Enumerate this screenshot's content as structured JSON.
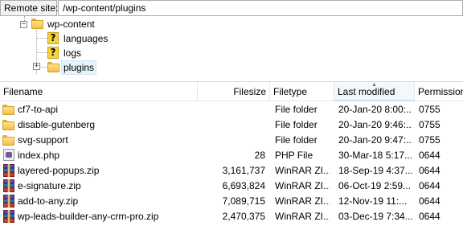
{
  "remote": {
    "label": "Remote site:",
    "path": "/wp-content/plugins"
  },
  "tree": {
    "root": {
      "label": "wp-content",
      "icon": "folder-open-icon",
      "expander": "−"
    },
    "children": [
      {
        "label": "languages",
        "icon": "unknown-folder-icon"
      },
      {
        "label": "logs",
        "icon": "unknown-folder-icon"
      },
      {
        "label": "plugins",
        "icon": "folder-icon",
        "expander": "+",
        "selected": true
      }
    ]
  },
  "columns": {
    "filename": "Filename",
    "filesize": "Filesize",
    "filetype": "Filetype",
    "last_modified": "Last modified",
    "permissions": "Permission"
  },
  "sorted_column": "last_modified",
  "files": [
    {
      "name": "cf7-to-api",
      "size": "",
      "type": "File folder",
      "modified": "20-Jan-20 8:00:...",
      "perm": "0755",
      "icon": "folder-icon"
    },
    {
      "name": "disable-gutenberg",
      "size": "",
      "type": "File folder",
      "modified": "20-Jan-20 9:46:...",
      "perm": "0755",
      "icon": "folder-icon"
    },
    {
      "name": "svg-support",
      "size": "",
      "type": "File folder",
      "modified": "20-Jan-20 9:47:...",
      "perm": "0755",
      "icon": "folder-icon"
    },
    {
      "name": "index.php",
      "size": "28",
      "type": "PHP File",
      "modified": "30-Mar-18 5:17...",
      "perm": "0644",
      "icon": "php-file-icon"
    },
    {
      "name": "layered-popups.zip",
      "size": "3,161,737",
      "type": "WinRAR ZI...",
      "modified": "18-Sep-19 4:37...",
      "perm": "0644",
      "icon": "rar-archive-icon"
    },
    {
      "name": "e-signature.zip",
      "size": "6,693,824",
      "type": "WinRAR ZI...",
      "modified": "06-Oct-19 2:59...",
      "perm": "0644",
      "icon": "rar-archive-icon"
    },
    {
      "name": "add-to-any.zip",
      "size": "7,089,715",
      "type": "WinRAR ZI...",
      "modified": "12-Nov-19 11:...",
      "perm": "0644",
      "icon": "rar-archive-icon"
    },
    {
      "name": "wp-leads-builder-any-crm-pro.zip",
      "size": "2,470,375",
      "type": "WinRAR ZI...",
      "modified": "03-Dec-19 7:34...",
      "perm": "0644",
      "icon": "rar-archive-icon"
    }
  ]
}
